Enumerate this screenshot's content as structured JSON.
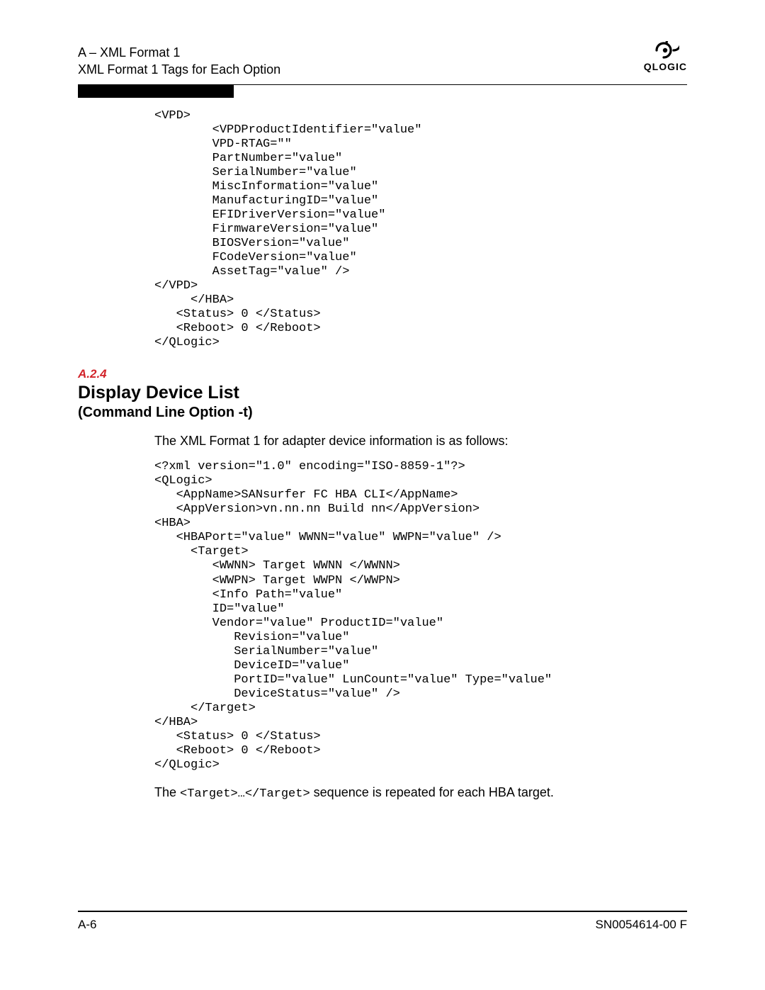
{
  "header": {
    "line1": "A – XML Format 1",
    "line2": "XML Format 1 Tags for Each Option",
    "logo_text": "QLOGIC"
  },
  "code1": "<VPD>\n        <VPDProductIdentifier=\"value\"\n        VPD-RTAG=\"\"\n        PartNumber=\"value\"\n        SerialNumber=\"value\"\n        MiscInformation=\"value\"\n        ManufacturingID=\"value\"\n        EFIDriverVersion=\"value\"\n        FirmwareVersion=\"value\"\n        BIOSVersion=\"value\"\n        FCodeVersion=\"value\"\n        AssetTag=\"value\" />\n</VPD>\n     </HBA>\n   <Status> 0 </Status>\n   <Reboot> 0 </Reboot>\n</QLogic>",
  "section": {
    "num": "A.2.4",
    "title": "Display Device List",
    "subtitle": "(Command Line Option -t)"
  },
  "body1": "The XML Format 1 for adapter device information is as follows:",
  "code2": "<?xml version=\"1.0\" encoding=\"ISO-8859-1\"?>\n<QLogic>\n   <AppName>SANsurfer FC HBA CLI</AppName>\n   <AppVersion>vn.nn.nn Build nn</AppVersion>\n<HBA>\n   <HBAPort=\"value\" WWNN=\"value\" WWPN=\"value\" />\n     <Target>\n        <WWNN> Target WWNN </WWNN>\n        <WWPN> Target WWPN </WWPN>\n        <Info Path=\"value\"\n        ID=\"value\"\n        Vendor=\"value\" ProductID=\"value\"\n           Revision=\"value\"\n           SerialNumber=\"value\"\n           DeviceID=\"value\"\n           PortID=\"value\" LunCount=\"value\" Type=\"value\"\n           DeviceStatus=\"value\" />\n     </Target>\n</HBA>\n   <Status> 0 </Status>\n   <Reboot> 0 </Reboot>\n</QLogic>",
  "body2_pre": "The ",
  "body2_mono": "<Target>…</Target>",
  "body2_post": " sequence is repeated for each HBA target.",
  "footer": {
    "left": "A-6",
    "right": "SN0054614-00  F"
  }
}
